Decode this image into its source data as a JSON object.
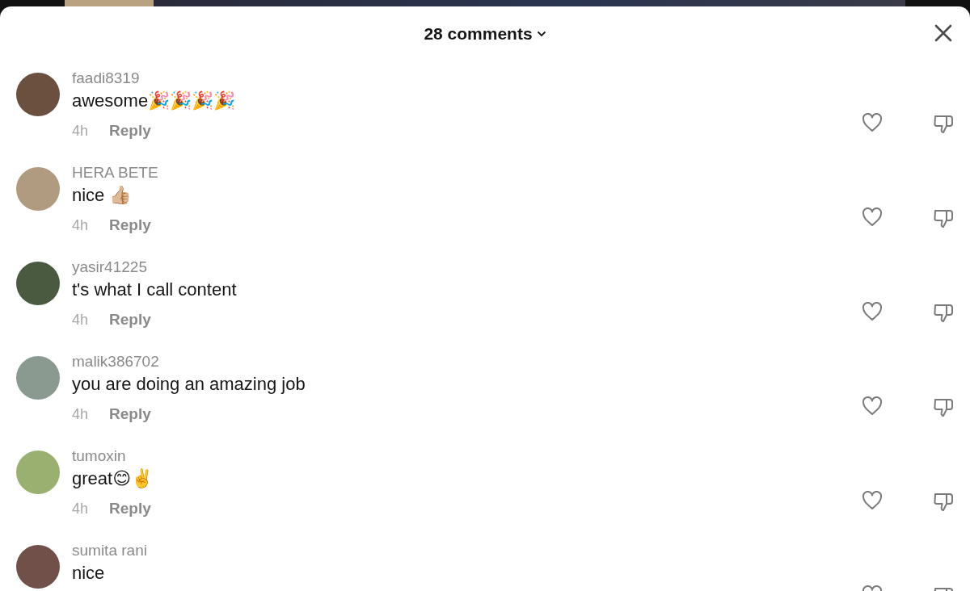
{
  "header": {
    "title": "28 comments"
  },
  "comments": [
    {
      "username": "faadi8319",
      "text": "awesome🎉🎉🎉🎉",
      "time": "4h",
      "reply": "Reply"
    },
    {
      "username": "HERA BETE",
      "text": "nice 👍🏼",
      "time": "4h",
      "reply": "Reply"
    },
    {
      "username": "yasir41225",
      "text": "t's what I call content",
      "time": "4h",
      "reply": "Reply"
    },
    {
      "username": "malik386702",
      "text": "you are doing an amazing job",
      "time": "4h",
      "reply": "Reply"
    },
    {
      "username": "tumoxin",
      "text": "great😊✌️",
      "time": "4h",
      "reply": "Reply"
    },
    {
      "username": "sumita rani",
      "text": "nice"
    }
  ]
}
